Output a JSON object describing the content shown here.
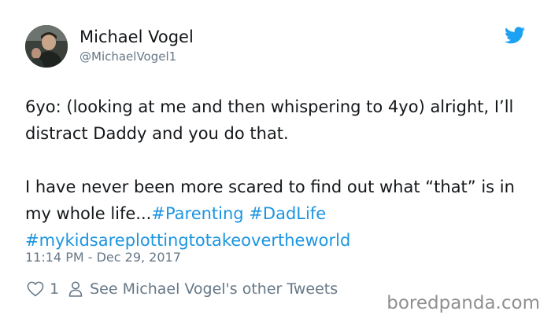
{
  "user": {
    "name": "Michael Vogel",
    "handle": "@MichaelVogel1"
  },
  "tweet": {
    "line1": "6yo: (looking at me and then whispering to 4yo) alright, I’ll distract Daddy and you do that.",
    "line2_text": "I have never been more scared to find out what “that” is in my whole life...",
    "hashtags": [
      "#Parenting",
      "#DadLife",
      "#mykidsareplottingtotakeovertheworld"
    ],
    "timestamp": "11:14 PM - Dec 29, 2017"
  },
  "actions": {
    "like_count": "1",
    "other_tweets_label": "See Michael Vogel's other Tweets"
  },
  "watermark": "boredpanda.com",
  "icons": {
    "brand": "twitter-bird-icon",
    "like": "heart-icon",
    "profile": "person-icon"
  },
  "colors": {
    "hashtag": "#1b95e0",
    "twitter_blue": "#1da1f2",
    "secondary_text": "#657786"
  }
}
